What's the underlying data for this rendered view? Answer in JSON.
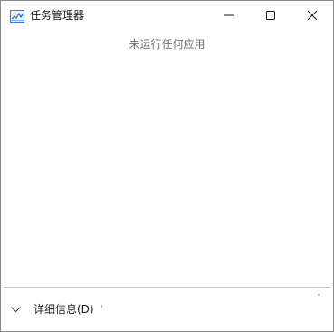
{
  "window": {
    "title": "任务管理器",
    "app_icon": "task-manager-icon"
  },
  "caption_buttons": {
    "minimize_icon": "minimize-icon",
    "maximize_icon": "maximize-icon",
    "close_icon": "close-icon"
  },
  "main": {
    "empty_message": "未运行任何应用"
  },
  "footer": {
    "details_label": "详细信息(D)",
    "chevron_icon": "chevron-down-icon"
  },
  "colors": {
    "window_bg": "#ffffff",
    "border": "#8a8a8a",
    "divider": "#c4c4c4",
    "muted_text": "#6e6e6e",
    "text": "#1a1a1a"
  }
}
